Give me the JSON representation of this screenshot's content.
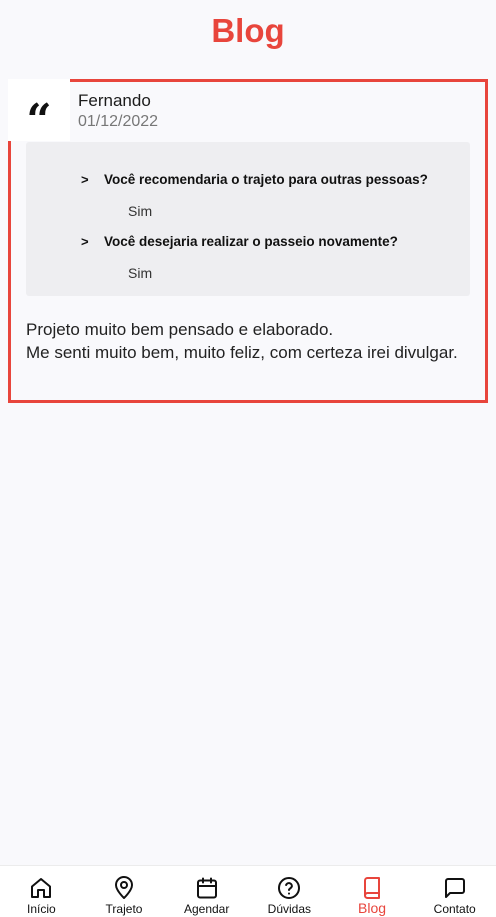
{
  "header": {
    "title": "Blog"
  },
  "post": {
    "quote_mark": "“",
    "author": "Fernando",
    "date": "01/12/2022",
    "qa": [
      {
        "marker": ">",
        "question": "Você recomendaria o trajeto para outras pessoas?",
        "answer": "Sim"
      },
      {
        "marker": ">",
        "question": "Você desejaria realizar o passeio novamente?",
        "answer": "Sim"
      }
    ],
    "body_lines": [
      "Projeto muito bem pensado e elaborado.",
      "Me senti muito bem, muito feliz, com certeza irei divulgar."
    ]
  },
  "nav": {
    "items": [
      {
        "label": "Início",
        "icon": "home-icon"
      },
      {
        "label": "Trajeto",
        "icon": "map-pin-icon"
      },
      {
        "label": "Agendar",
        "icon": "calendar-icon"
      },
      {
        "label": "Dúvidas",
        "icon": "help-circle-icon"
      },
      {
        "label": "Blog",
        "icon": "book-icon",
        "active": true
      },
      {
        "label": "Contato",
        "icon": "message-square-icon"
      }
    ]
  },
  "colors": {
    "accent": "#e8453c",
    "background": "#f9f9fc",
    "qa_background": "#eeeef1"
  }
}
